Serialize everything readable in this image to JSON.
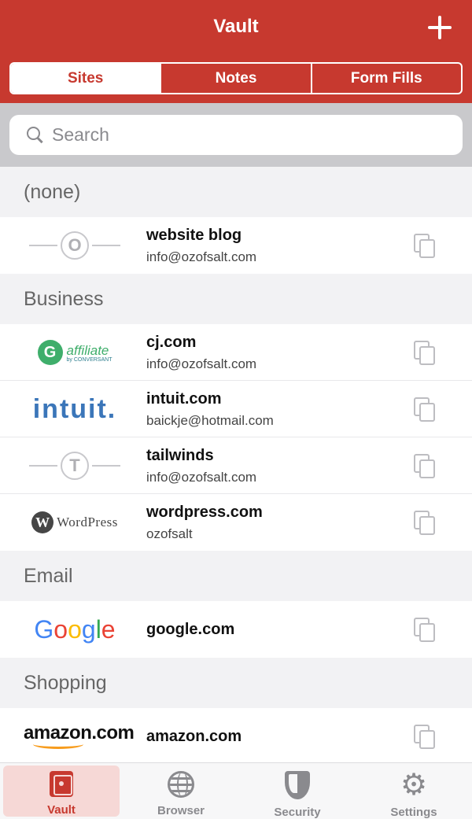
{
  "header": {
    "title": "Vault",
    "add_icon": "plus-icon"
  },
  "segments": [
    {
      "label": "Sites",
      "active": true
    },
    {
      "label": "Notes",
      "active": false
    },
    {
      "label": "Form Fills",
      "active": false
    }
  ],
  "search": {
    "placeholder": "Search",
    "value": "",
    "icon": "search-icon"
  },
  "sections": [
    {
      "title": "(none)",
      "items": [
        {
          "name": "website blog",
          "username": "info@ozofsalt.com",
          "logo": "placeholder",
          "logo_letter": "O"
        }
      ]
    },
    {
      "title": "Business",
      "items": [
        {
          "name": "cj.com",
          "username": "info@ozofsalt.com",
          "logo": "affiliate",
          "logo_text": "affiliate",
          "logo_subtext": "by CONVERSANT",
          "logo_glyph": "G"
        },
        {
          "name": "intuit.com",
          "username": "baickje@hotmail.com",
          "logo": "intuit",
          "logo_text": "intuit."
        },
        {
          "name": "tailwinds",
          "username": "info@ozofsalt.com",
          "logo": "placeholder",
          "logo_letter": "T"
        },
        {
          "name": "wordpress.com",
          "username": "ozofsalt",
          "logo": "wordpress",
          "logo_text": "WordPress",
          "logo_glyph": "W"
        }
      ]
    },
    {
      "title": "Email",
      "items": [
        {
          "name": "google.com",
          "username": "",
          "logo": "google",
          "logo_letters": [
            "G",
            "o",
            "o",
            "g",
            "l",
            "e"
          ]
        }
      ]
    },
    {
      "title": "Shopping",
      "items": [
        {
          "name": "amazon.com",
          "username": "",
          "logo": "amazon",
          "logo_text": "amazon.com"
        }
      ]
    }
  ],
  "tabbar": [
    {
      "label": "Vault",
      "icon": "safe-icon",
      "active": true
    },
    {
      "label": "Browser",
      "icon": "globe-icon",
      "active": false
    },
    {
      "label": "Security",
      "icon": "shield-icon",
      "active": false
    },
    {
      "label": "Settings",
      "icon": "gear-icon",
      "active": false
    }
  ],
  "colors": {
    "brand_red": "#c7392f",
    "active_tab_bg": "#f6d8d6",
    "inactive_gray": "#8a8a8e"
  }
}
